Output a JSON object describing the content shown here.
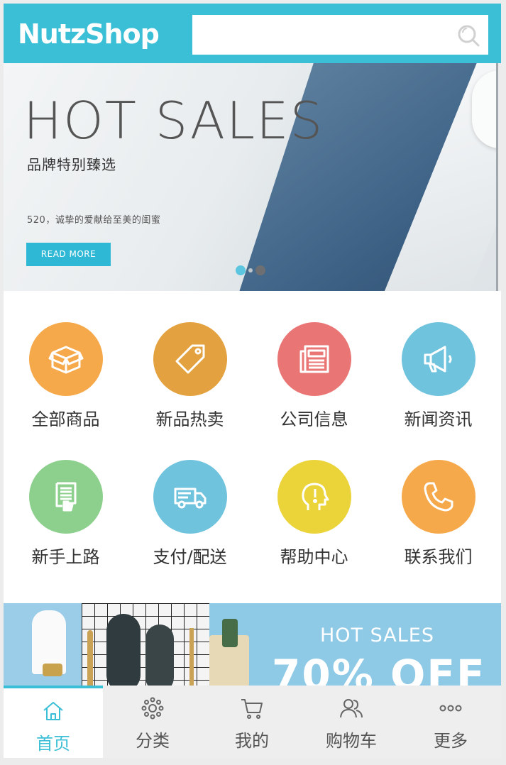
{
  "header": {
    "logo": "NutzShop",
    "search_placeholder": ""
  },
  "banner": {
    "title": "HOT SALES",
    "subtitle": "品牌特别臻选",
    "description": "520，诚挚的爱献给至美的闺蜜",
    "button": "READ MORE"
  },
  "categories": [
    {
      "label": "全部商品",
      "color": "#f6a94a",
      "icon": "box-icon"
    },
    {
      "label": "新品热卖",
      "color": "#e3a23f",
      "icon": "tag-icon"
    },
    {
      "label": "公司信息",
      "color": "#ea7575",
      "icon": "newspaper-icon"
    },
    {
      "label": "新闻资讯",
      "color": "#6fc3dd",
      "icon": "megaphone-icon"
    },
    {
      "label": "新手上路",
      "color": "#8dd08d",
      "icon": "guide-icon"
    },
    {
      "label": "支付/配送",
      "color": "#6fc3dd",
      "icon": "truck-icon"
    },
    {
      "label": "帮助中心",
      "color": "#ebd43a",
      "icon": "help-head-icon"
    },
    {
      "label": "联系我们",
      "color": "#f6a94a",
      "icon": "phone-icon"
    }
  ],
  "promo": {
    "title": "HOT SALES",
    "big_text": "70% OFF"
  },
  "tabbar": [
    {
      "label": "首页",
      "icon": "home-icon",
      "active": true
    },
    {
      "label": "分类",
      "icon": "category-icon",
      "active": false
    },
    {
      "label": "我的",
      "icon": "cart-icon",
      "active": false
    },
    {
      "label": "购物车",
      "icon": "user-icon",
      "active": false
    },
    {
      "label": "更多",
      "icon": "more-icon",
      "active": false
    }
  ],
  "colors": {
    "accent": "#3bbfd6"
  }
}
